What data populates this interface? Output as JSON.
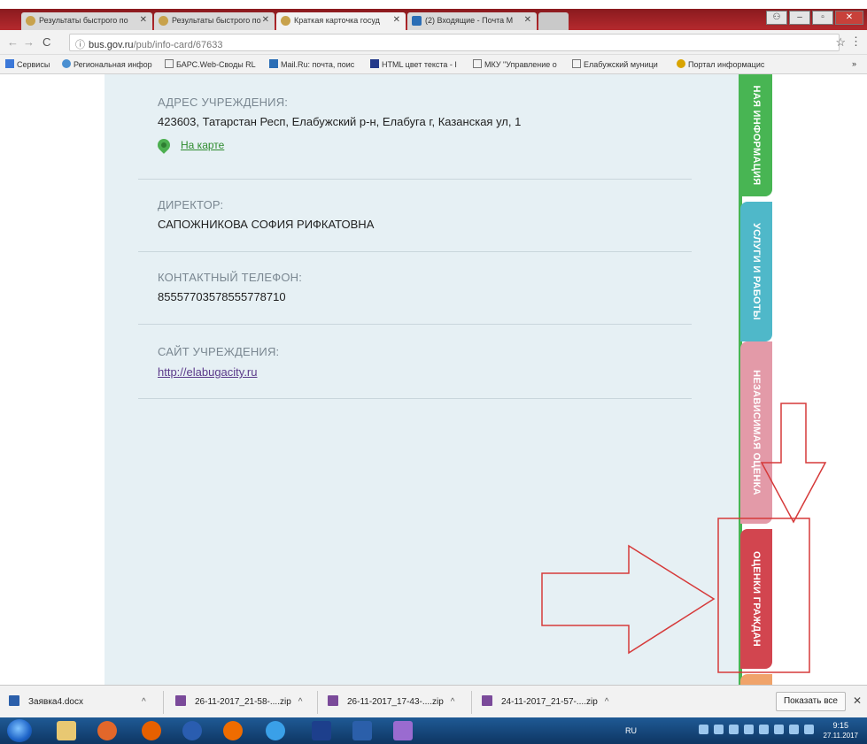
{
  "browser": {
    "tabs": [
      {
        "label": "Результаты быстрого по"
      },
      {
        "label": "Результаты быстрого по"
      },
      {
        "label": "Краткая карточка госуд"
      },
      {
        "label": "(2) Входящие - Почта М"
      }
    ],
    "url_host": "bus.gov.ru",
    "url_path": "/pub/info-card/67633",
    "bookmarks": [
      {
        "label": "Сервисы"
      },
      {
        "label": "Региональная инфор"
      },
      {
        "label": "БАРС.Web-Своды RL"
      },
      {
        "label": "Mail.Ru: почта, поис"
      },
      {
        "label": "HTML цвет текста - I"
      },
      {
        "label": "МКУ \"Управление о"
      },
      {
        "label": "Елабужский муници"
      },
      {
        "label": "Портал информацис"
      }
    ],
    "bookmarks_more": "»"
  },
  "card": {
    "address": {
      "label": "АДРЕС УЧРЕЖДЕНИЯ:",
      "value": "423603, Татарстан Респ, Елабужский р-н, Елабуга г, Казанская ул, 1",
      "map_link": "На карте"
    },
    "director": {
      "label": "ДИРЕКТОР:",
      "value": "САПОЖНИКОВА СОФИЯ РИФКАТОВНА"
    },
    "phone": {
      "label": "КОНТАКТНЫЙ ТЕЛЕФОН:",
      "value": "85557703578555778710"
    },
    "site": {
      "label": "САЙТ УЧРЕЖДЕНИЯ:",
      "value": "http://elabugacity.ru"
    }
  },
  "side_tabs": [
    {
      "label": "НАЯ ИНФОРМАЦИЯ",
      "color": "#48b553"
    },
    {
      "label": "УСЛУГИ И РАБОТЫ",
      "color": "#4fb8c9"
    },
    {
      "label": "НЕЗАВИСИМАЯ ОЦЕНКА",
      "color": "#e39aa8"
    },
    {
      "label": "ОЦЕНКИ ГРАЖДАН",
      "color": "#d2454f"
    }
  ],
  "downloads": {
    "items": [
      {
        "label": "Заявка4.docx"
      },
      {
        "label": "26-11-2017_21-58-....zip"
      },
      {
        "label": "26-11-2017_17-43-....zip"
      },
      {
        "label": "24-11-2017_21-57-....zip"
      }
    ],
    "show_all": "Показать все",
    "close": "✕"
  },
  "taskbar": {
    "lang": "RU",
    "time": "9:15",
    "date": "27.11.2017"
  }
}
